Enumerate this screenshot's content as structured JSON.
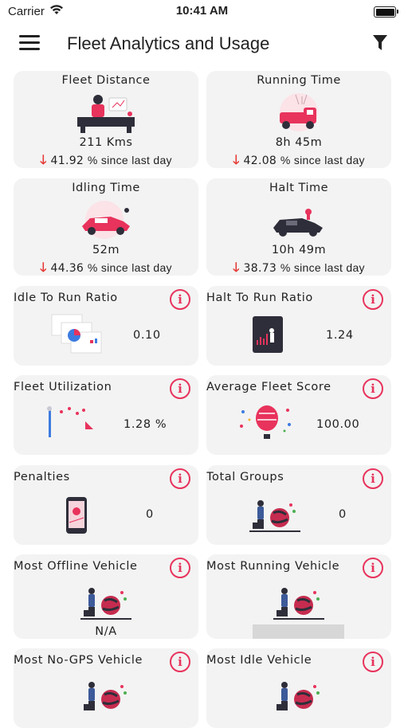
{
  "status": {
    "carrier": "Carrier",
    "time": "10:41 AM"
  },
  "header": {
    "title": "Fleet Analytics and Usage"
  },
  "stats": [
    {
      "label": "Fleet Distance",
      "value": "211 Kms",
      "delta_value": "41.92",
      "delta_text": "% since last day",
      "illustration": "desk-illustration"
    },
    {
      "label": "Running Time",
      "value": "8h 45m",
      "delta_value": "42.08",
      "delta_text": "% since last day",
      "illustration": "red-truck-illustration"
    },
    {
      "label": "Idling Time",
      "value": "52m",
      "delta_value": "44.36",
      "delta_text": "% since last day",
      "illustration": "red-car-illustration"
    },
    {
      "label": "Halt Time",
      "value": "10h 49m",
      "delta_value": "38.73",
      "delta_text": "% since last day",
      "illustration": "dark-car-illustration"
    }
  ],
  "metrics": [
    {
      "label": "Idle To Run Ratio",
      "value": "0.10",
      "icon": "info-icon",
      "illustration": "charts-illustration"
    },
    {
      "label": "Halt To Run Ratio",
      "value": "1.24",
      "icon": "info-icon",
      "illustration": "tablet-illustration"
    },
    {
      "label": "Fleet Utilization",
      "value": "1.28 %",
      "icon": "info-icon",
      "illustration": "utilization-illustration"
    },
    {
      "label": "Average Fleet Score",
      "value": "100.00",
      "icon": "info-icon",
      "illustration": "balloon-illustration"
    },
    {
      "label": "Penalties",
      "value": "0",
      "icon": "info-icon",
      "illustration": "phone-map-illustration"
    },
    {
      "label": "Total Groups",
      "value": "0",
      "icon": "info-icon",
      "illustration": "globe-person-illustration"
    },
    {
      "label": "Most Offline Vehicle",
      "value": "N/A",
      "icon": "info-icon",
      "illustration": "globe-person-illustration"
    },
    {
      "label": "Most Running Vehicle",
      "value": "",
      "icon": "info-icon",
      "illustration": "globe-person-illustration"
    },
    {
      "label": "Most No-GPS Vehicle",
      "value": "",
      "icon": "info-icon",
      "illustration": "globe-person-illustration"
    },
    {
      "label": "Most Idle Vehicle",
      "value": "",
      "icon": "info-icon",
      "illustration": "globe-person-illustration"
    }
  ],
  "colors": {
    "accent": "#e8335c",
    "down_arrow": "#e53935",
    "card_bg": "#f3f3f3"
  }
}
